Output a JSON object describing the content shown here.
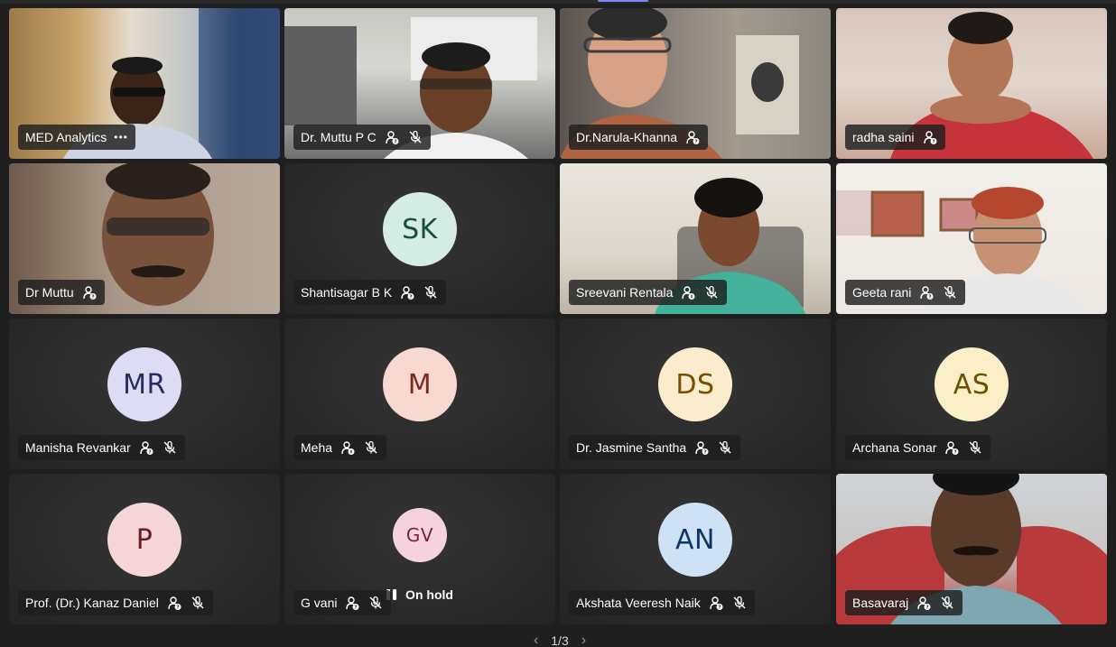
{
  "participants": [
    {
      "name": "MED Analytics",
      "mic": "none",
      "extra": "more-options"
    },
    {
      "name": "Dr. Muttu P C",
      "mic": "muted"
    },
    {
      "name": "Dr.Narula-Khanna",
      "mic": "none",
      "active": true
    },
    {
      "name": "radha saini",
      "mic": "none"
    },
    {
      "name": "Dr Muttu",
      "mic": "none"
    },
    {
      "name": "Shantisagar B K",
      "mic": "muted",
      "initials": "SK"
    },
    {
      "name": "Sreevani Rentala",
      "mic": "muted"
    },
    {
      "name": "Geeta rani",
      "mic": "muted"
    },
    {
      "name": "Manisha Revankar",
      "mic": "muted",
      "initials": "MR"
    },
    {
      "name": "Meha",
      "mic": "muted",
      "initials": "M"
    },
    {
      "name": "Dr. Jasmine Santha",
      "mic": "muted",
      "initials": "DS"
    },
    {
      "name": "Archana Sonar",
      "mic": "muted",
      "initials": "AS"
    },
    {
      "name": "Prof. (Dr.) Kanaz Daniel",
      "mic": "muted",
      "initials": "P"
    },
    {
      "name": "G vani",
      "mic": "muted",
      "initials": "GV",
      "status": "On hold"
    },
    {
      "name": "Akshata Veeresh Naik",
      "mic": "muted",
      "initials": "AN"
    },
    {
      "name": "Basavaraj",
      "mic": "muted"
    }
  ],
  "more_options_label": "•••",
  "pager": {
    "text": "1/3",
    "prev": "‹",
    "next": "›"
  },
  "colors": {
    "accent": "#7f85f5",
    "avatar_sk": {
      "bg": "#d4ece4",
      "fg": "#1b4d3e"
    },
    "avatar_mr": {
      "bg": "#dcdcf5",
      "fg": "#2b2b63"
    },
    "avatar_m": {
      "bg": "#f7d9d2",
      "fg": "#7a2a1c"
    },
    "avatar_ds": {
      "bg": "#faeccc",
      "fg": "#7a4e00"
    },
    "avatar_as": {
      "bg": "#fbefc8",
      "fg": "#6e5200"
    },
    "avatar_p": {
      "bg": "#f6d5d8",
      "fg": "#6c1a24"
    },
    "avatar_gv": {
      "bg": "#f5d2dd",
      "fg": "#7b1f3d"
    },
    "avatar_an": {
      "bg": "#cfe1f5",
      "fg": "#0f3565"
    }
  }
}
